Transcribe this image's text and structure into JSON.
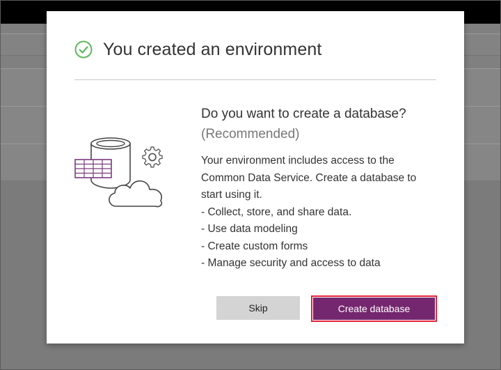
{
  "dialog": {
    "title": "You created an environment",
    "question": "Do you want to create a database?",
    "recommended": "(Recommended)",
    "body_lines": [
      "Your environment includes access to the",
      "Common Data Service. Create a database to",
      "start using it.",
      "- Collect, store, and share data.",
      "- Use data modeling",
      "- Create custom forms",
      "- Manage security and access to data"
    ],
    "buttons": {
      "skip": "Skip",
      "create": "Create database"
    }
  },
  "icons": {
    "status": "check-circle-icon",
    "illustration": "database-cloud-illustration"
  },
  "colors": {
    "accent": "#742774",
    "success": "#5cb85c",
    "highlight_border": "#e3233c"
  }
}
